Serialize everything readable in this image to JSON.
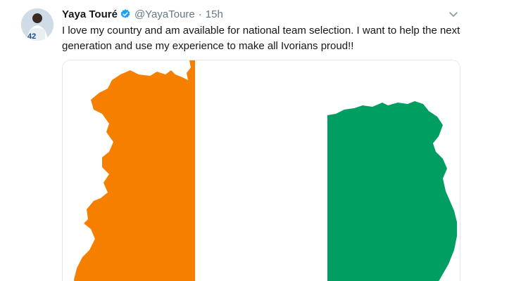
{
  "tweet": {
    "display_name": "Yaya Touré",
    "handle": "@YayaToure",
    "separator": "·",
    "time": "15h",
    "text": "I love my country and am available for national team selection. I want to help the next generation and use my experience to make all Ivorians proud!!",
    "avatar_number": "42"
  },
  "icons": {
    "verified": "verified-badge-icon",
    "more": "chevron-down-icon"
  },
  "colors": {
    "orange": "#f77f00",
    "white": "#ffffff",
    "green": "#009e60",
    "verified_blue": "#1da1f2"
  }
}
